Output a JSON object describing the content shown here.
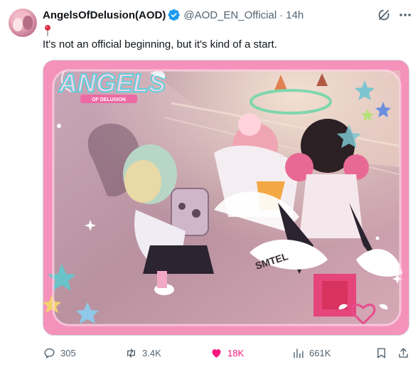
{
  "post": {
    "author_name": "AngelsOfDelusion(AOD)",
    "handle": "@AOD_EN_Official",
    "separator": "·",
    "timestamp": "14h",
    "text": "It's not an official beginning, but it's kind of a start.",
    "verified": true
  },
  "media": {
    "logo_title": "ANGELS",
    "logo_subtitle": "OF DELUSION",
    "sign_text": "SMTEL"
  },
  "actions": {
    "replies": "305",
    "reposts": "3.4K",
    "likes": "18K",
    "views": "661K",
    "liked": true
  },
  "colors": {
    "verified": "#1d9bf0",
    "like": "#f91880",
    "muted_text": "#536471",
    "frame_pink": "#f592bb"
  }
}
